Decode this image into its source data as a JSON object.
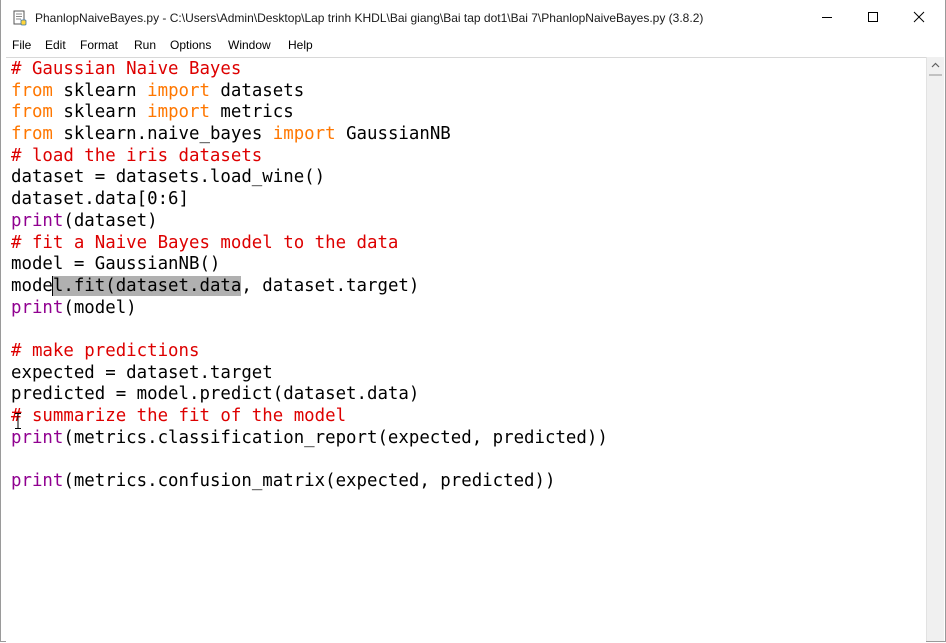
{
  "window": {
    "title": "PhanlopNaiveBayes.py - C:\\Users\\Admin\\Desktop\\Lap trinh KHDL\\Bai giang\\Bai tap dot1\\Bai 7\\PhanlopNaiveBayes.py (3.8.2)",
    "app_icon": "python-idle-icon",
    "controls": [
      "minimize-icon",
      "maximize-icon",
      "close-icon"
    ]
  },
  "menubar": {
    "items": [
      "File",
      "Edit",
      "Format",
      "Run",
      "Options",
      "Window",
      "Help"
    ]
  },
  "editor": {
    "lines": [
      "# Gaussian Naive Bayes",
      "from sklearn import datasets",
      "from sklearn import metrics",
      "from sklearn.naive_bayes import GaussianNB",
      "# load the iris datasets",
      "dataset = datasets.load_wine()",
      "dataset.data[0:6]",
      "print(dataset)",
      "# fit a Naive Bayes model to the data",
      "model = GaussianNB()",
      "model.fit(dataset.data, dataset.target)",
      "print(model)",
      "",
      "# make predictions",
      "expected = dataset.target",
      "predicted = model.predict(dataset.data)",
      "# summarize the fit of the model",
      "print(metrics.classification_report(expected, predicted))",
      "",
      "print(metrics.confusion_matrix(expected, predicted))"
    ],
    "selected_text": "l.fit(dataset.data",
    "selection_line": 11
  },
  "colors": {
    "comment": "#dd0000",
    "keyword": "#ff7700",
    "builtin": "#900090",
    "selection": "#b0b0b0"
  }
}
